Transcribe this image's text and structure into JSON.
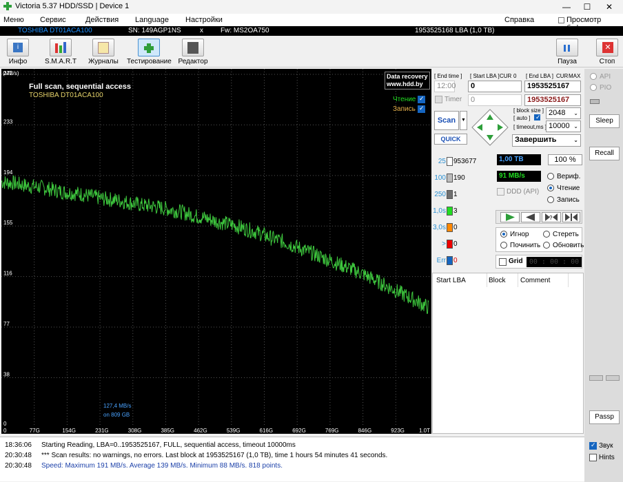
{
  "window": {
    "title": "Victoria 5.37 HDD/SSD | Device 1",
    "min": "—",
    "max": "☐",
    "close": "✕"
  },
  "menu": {
    "items": [
      "Меню",
      "Сервис",
      "Действия",
      "Language",
      "Настройки"
    ],
    "help": "Справка",
    "buffer": "Просмотр буфера"
  },
  "device": {
    "model": "TOSHIBA DT01ACA100",
    "serial": "SN: 149AGP1NS",
    "x": "x",
    "firmware": "Fw: MS2OA750",
    "size": "1953525168 LBA (1,0 TB)"
  },
  "toolbar": {
    "info": "Инфо",
    "smart": "S.M.A.R.T",
    "logs": "Журналы",
    "testing": "Тестирование",
    "editor": "Редактор",
    "pause": "Пауза",
    "stop": "Стоп"
  },
  "graph": {
    "scan_title": "Full scan, sequential access",
    "model": "TOSHIBA DT01ACA100",
    "brand_line1": "Data recovery",
    "brand_line2": "www.hdd.by",
    "read_label": "Чтение",
    "write_label": "Запись",
    "speed_note": "127,4 MB/s",
    "position_note": "on 809 GB",
    "y_unit": "(MB/s)"
  },
  "chart_data": {
    "type": "line",
    "ylabel": "MB/s",
    "ylim": [
      0,
      272
    ],
    "yticks": [
      "272",
      "233",
      "194",
      "155",
      "116",
      "77",
      "38",
      "0"
    ],
    "xticks": [
      "0",
      "77G",
      "154G",
      "231G",
      "308G",
      "385G",
      "462G",
      "539G",
      "616G",
      "692G",
      "769G",
      "846G",
      "923G",
      "1.0T"
    ],
    "xlim": [
      0,
      1000
    ],
    "series": [
      {
        "x": [
          0,
          30,
          60,
          90,
          120,
          150,
          180,
          210,
          240,
          270,
          300,
          330,
          360,
          390,
          420,
          450,
          480,
          510,
          540,
          570,
          600,
          630,
          660,
          690,
          720,
          750,
          780,
          810,
          840,
          870,
          900,
          930,
          960,
          1000
        ],
        "values": [
          189,
          188,
          186,
          185,
          183,
          181,
          180,
          178,
          176,
          175,
          173,
          171,
          170,
          168,
          166,
          163,
          161,
          158,
          156,
          153,
          150,
          146,
          143,
          139,
          135,
          131,
          127,
          123,
          119,
          114,
          109,
          104,
          99,
          92
        ]
      }
    ]
  },
  "panel": {
    "end_time_label": "[ End time ]",
    "start_lba_label": "[ Start LBA ]",
    "cur_label": "CUR",
    "cur_value": "0",
    "end_lba_label": "[ End LBA ]",
    "cur2_label": "CUR",
    "max_label": "MAX",
    "time_value": "12:00",
    "start_lba": "0",
    "end_lba": "1953525167",
    "timer_label": "Timer",
    "timer_value": "0",
    "end_lba2": "1953525167",
    "scan_btn": "Scan",
    "quick_btn": "QUICK",
    "block_size_label": "[ block size ]",
    "auto_label": "[ auto ]",
    "block_size": "2048",
    "timeout_label": "[ timeout,ms ]",
    "timeout": "10000",
    "finish": "Завершить",
    "stats": [
      {
        "label": "25",
        "value": "953677",
        "color": "#ffffff"
      },
      {
        "label": "100",
        "value": "190",
        "color": "#bdbdbd"
      },
      {
        "label": "250",
        "value": "1",
        "color": "#707070"
      },
      {
        "label": "1,0s",
        "value": "3",
        "color": "#22dd22"
      },
      {
        "label": "3,0s",
        "value": "0",
        "color": "#ff8800"
      },
      {
        "label": ">",
        "value": "0",
        "color": "#ee0000"
      },
      {
        "label": "Err",
        "value": "0",
        "color": "#1565c0"
      }
    ],
    "progress_size": "1,00 TB",
    "progress_pct": "100",
    "pct_sign": "%",
    "speed": "91 MB/s",
    "ddd": "DDD (API)",
    "verify": "Вериф.",
    "read": "Чтение",
    "write": "Запись",
    "ignore": "Игнор",
    "erase": "Стереть",
    "repair": "Починить",
    "refresh": "Обновить",
    "grid": "Grid",
    "timer_display": "00 : 00 : 00",
    "table_headers": [
      "Start LBA",
      "Block",
      "Comment"
    ]
  },
  "right": {
    "api": "API",
    "pio": "PIO",
    "sleep": "Sleep",
    "recall": "Recall",
    "passp": "Passp",
    "sound": "Звук",
    "hints": "Hints"
  },
  "log": [
    {
      "time": "18:36:06",
      "msg": "Starting Reading, LBA=0..1953525167, FULL, sequential access, timeout 10000ms",
      "color": "#000000"
    },
    {
      "time": "20:30:48",
      "msg": "*** Scan results: no warnings, no errors. Last block at 1953525167 (1,0 TB), time 1 hours 54 minutes 41 seconds.",
      "color": "#000000"
    },
    {
      "time": "20:30:48",
      "msg": "Speed: Maximum 191 MB/s. Average 139 MB/s. Minimum 88 MB/s. 818 points.",
      "color": "#1a3fa8"
    }
  ]
}
